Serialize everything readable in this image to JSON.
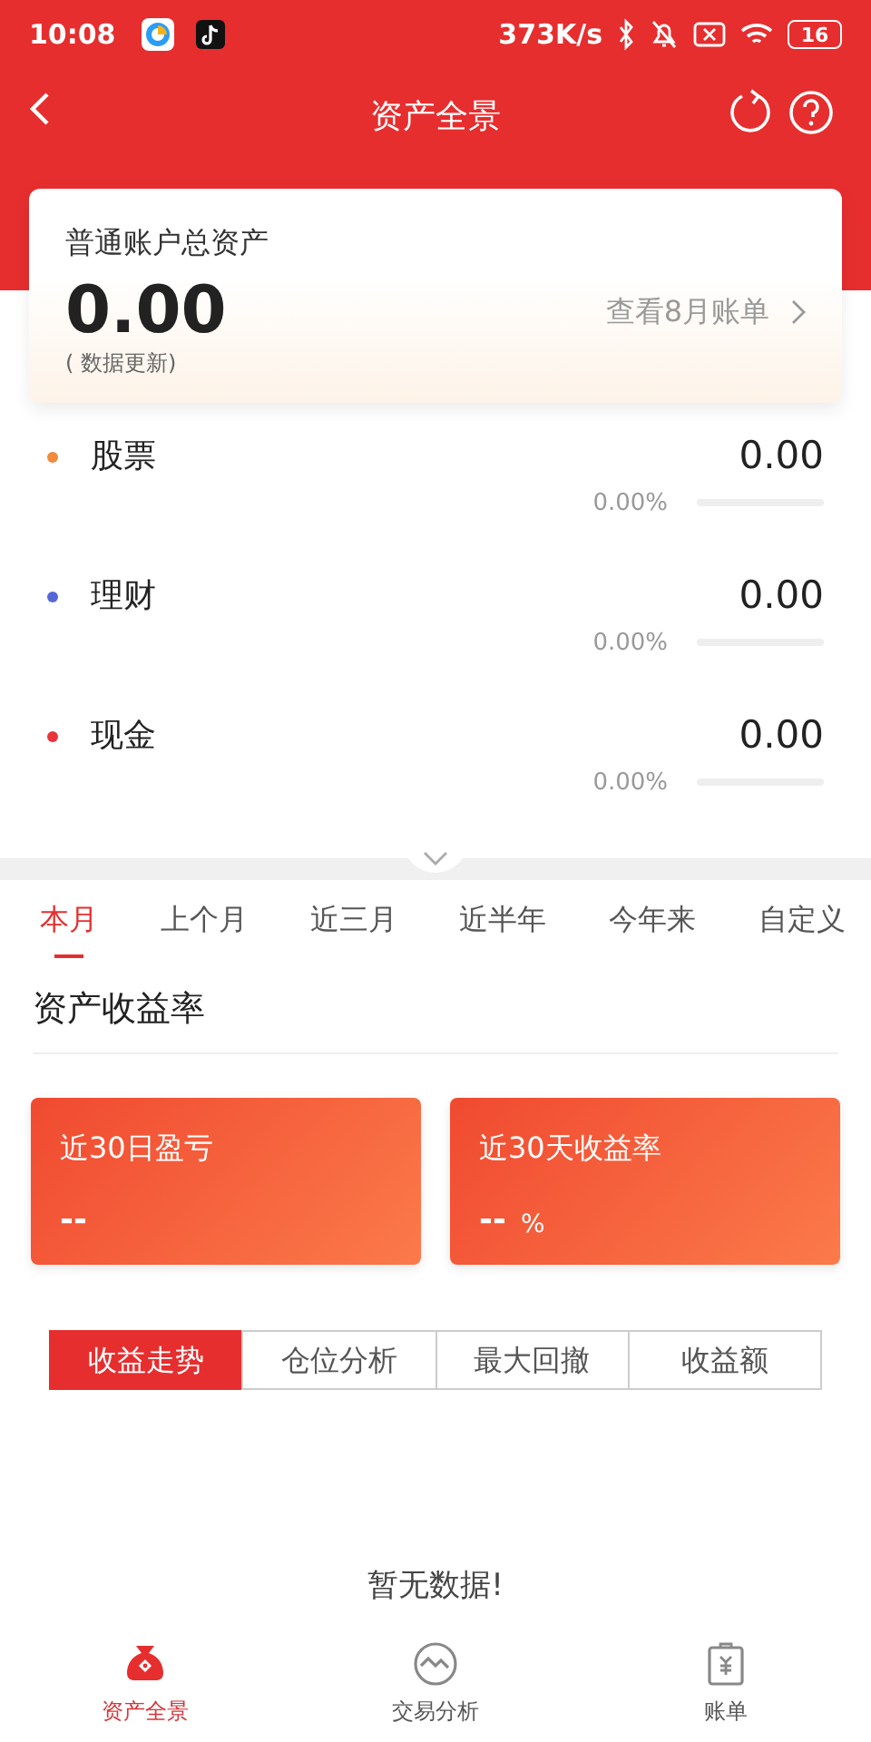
{
  "status_bar": {
    "time": "10:08",
    "speed": "373K/s",
    "battery": "16"
  },
  "header": {
    "title": "资产全景"
  },
  "summary": {
    "label": "普通账户总资产",
    "amount": "0.00",
    "note": "( 数据更新)",
    "link": "查看8月账单"
  },
  "assets": [
    {
      "name": "股票",
      "color": "#f08a3c",
      "value": "0.00",
      "percent": "0.00%",
      "level": 0
    },
    {
      "name": "理财",
      "color": "#5567d8",
      "value": "0.00",
      "percent": "0.00%",
      "level": 0
    },
    {
      "name": "现金",
      "color": "#e8353a",
      "value": "0.00",
      "percent": "0.00%",
      "level": 0
    }
  ],
  "period_tabs": [
    {
      "label": "本月",
      "selected": true
    },
    {
      "label": "上个月",
      "selected": false
    },
    {
      "label": "近三月",
      "selected": false
    },
    {
      "label": "近半年",
      "selected": false
    },
    {
      "label": "今年来",
      "selected": false
    },
    {
      "label": "自定义",
      "selected": false
    }
  ],
  "section_title": "资产收益率",
  "stat_cards": [
    {
      "label": "近30日盈亏",
      "value": "--"
    },
    {
      "label": "近30天收益率",
      "value": "--",
      "unit": "%"
    }
  ],
  "segments": [
    {
      "label": "收益走势",
      "selected": true
    },
    {
      "label": "仓位分析",
      "selected": false
    },
    {
      "label": "最大回撤",
      "selected": false
    },
    {
      "label": "收益额",
      "selected": false
    }
  ],
  "empty_text": "暂无数据!",
  "bottom_nav": [
    {
      "kind": "bag",
      "label": "资产全景",
      "selected": true
    },
    {
      "kind": "wave",
      "label": "交易分析",
      "selected": false
    },
    {
      "kind": "bill",
      "label": "账单",
      "selected": false
    }
  ]
}
